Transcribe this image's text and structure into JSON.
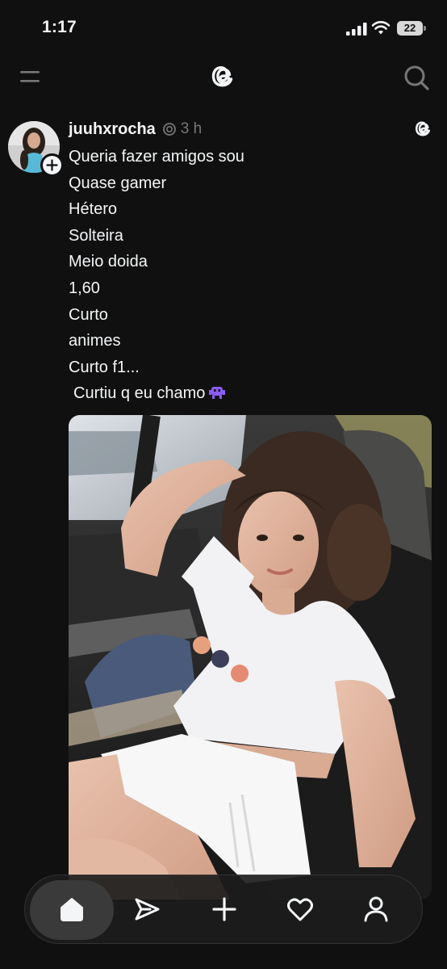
{
  "status_bar": {
    "time": "1:17",
    "battery": "22"
  },
  "top_nav": {
    "menu_icon": "menu-icon",
    "logo_icon": "threads-logo",
    "search_icon": "search-icon"
  },
  "post": {
    "username": "juuhxrocha",
    "time": "3 h",
    "lines": [
      "Queria fazer amigos sou",
      "Quase gamer",
      "Hétero",
      "Solteira",
      "Meio doida",
      "1,60",
      "Curto",
      "animes",
      "Curto f1...",
      "Curtiu q eu chamo"
    ],
    "emoji_icon": "alien-monster-icon"
  },
  "tab_bar": {
    "tabs": [
      "home-icon",
      "send-icon",
      "plus-icon",
      "heart-icon",
      "profile-icon"
    ],
    "active": "home-icon"
  },
  "colors": {
    "background": "#101010",
    "text": "#f3f5f7",
    "muted": "#777777",
    "emoji": "#8a5cf6"
  }
}
